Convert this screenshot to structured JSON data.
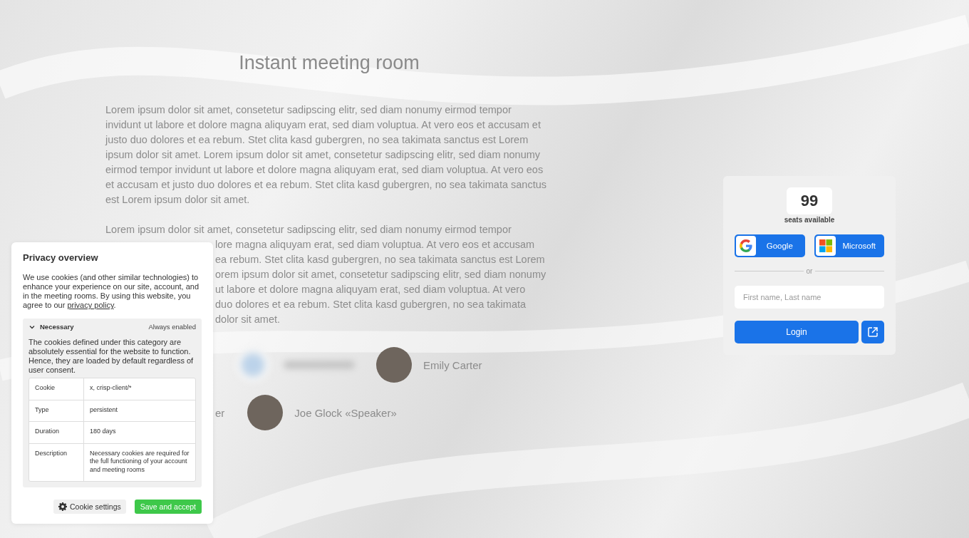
{
  "main": {
    "title": "Instant meeting room",
    "intro": "Lorem ipsum dolor sit amet, consetetur sadipscing elitr, sed diam nonumy eirmod tempor invidunt ut labore et dolore magna aliquyam erat, sed diam voluptua. At vero eos et accusam et justo duo dolores et ea rebum. Stet clita kasd gubergren, no sea takimata sanctus est Lorem ipsum dolor sit amet. Lorem ipsum dolor sit amet, consetetur sadipscing elitr, sed diam nonumy eirmod tempor invidunt ut labore et dolore magna aliquyam erat, sed diam voluptua. At vero eos et accusam et justo duo dolores et ea rebum. Stet clita kasd gubergren, no sea takimata sanctus est Lorem ipsum dolor sit amet.",
    "second_paragraph_lines": [
      {
        "kind": "full",
        "text": "Lorem ipsum dolor sit amet, consetetur sadipscing elitr, sed diam nonumy eirmod tempor"
      },
      {
        "kind": "cut",
        "text": "lore magna aliquyam erat, sed diam voluptua. At vero eos et accusam"
      },
      {
        "kind": "cut",
        "text": "ea rebum. Stet clita kasd gubergren, no sea takimata sanctus est Lorem"
      },
      {
        "kind": "cut",
        "text": "orem ipsum dolor sit amet, consetetur sadipscing elitr, sed diam nonumy"
      },
      {
        "kind": "cut",
        "text": "ut labore et dolore magna aliquyam erat, sed diam voluptua. At vero"
      },
      {
        "kind": "cut",
        "text": "duo dolores et ea rebum. Stet clita kasd gubergren, no sea takimata"
      },
      {
        "kind": "cut",
        "text": "dolor sit amet."
      }
    ],
    "participant_rows": [
      [
        {
          "kind": "blurred"
        },
        {
          "kind": "person",
          "name": "Emily Carter"
        }
      ],
      [
        {
          "kind": "cut",
          "name": "er"
        },
        {
          "kind": "person",
          "name": "Joe Glock «Speaker»"
        }
      ]
    ]
  },
  "login_card": {
    "seats": "99",
    "seats_label": "seats available",
    "providers": [
      {
        "kind": "google",
        "label": "Google"
      },
      {
        "kind": "microsoft",
        "label": "Microsoft"
      }
    ],
    "divider_text": "or",
    "name_field": {
      "placeholder": "First name, Last name"
    },
    "login_button": "Login"
  },
  "cookie_panel": {
    "title": "Privacy overview",
    "text_before": "We use cookies (and other similar technologies) to enhance your experience on our site, account, and in the meeting rooms. By using this website, you agree to our ",
    "link": "privacy policy",
    "text_after": ".",
    "section": {
      "title": "Necessary",
      "expanded": true,
      "status": "Always enabled",
      "description": "The cookies defined under this category are absolutely essential for the website to function. Hence, they are loaded by default regardless of user consent.",
      "rows": [
        {
          "label": "Cookie",
          "value": "x, crisp-client/*"
        },
        {
          "label": "Type",
          "value": "persistent"
        },
        {
          "label": "Duration",
          "value": "180 days"
        },
        {
          "label": "Description",
          "value": "Necessary cookies are required for the full functioning of your account and meeting rooms"
        }
      ]
    },
    "buttons": {
      "settings": "Cookie settings",
      "accept": "Save and accept"
    }
  }
}
